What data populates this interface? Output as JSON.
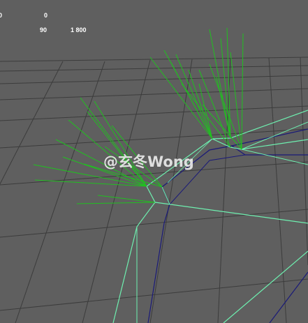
{
  "viewport": {
    "background": "#5f5f5f",
    "grid_color": "#3c3c3c",
    "wire_outer_color": "#6ef0b0",
    "wire_inner_color": "#1a1a78",
    "normals_color": "#20c020",
    "heads_up_display": {
      "value_a": "0",
      "value_b": "0",
      "value_c": "90",
      "value_d": "1 800"
    }
  },
  "watermark": {
    "text": "@玄冬Wong"
  }
}
